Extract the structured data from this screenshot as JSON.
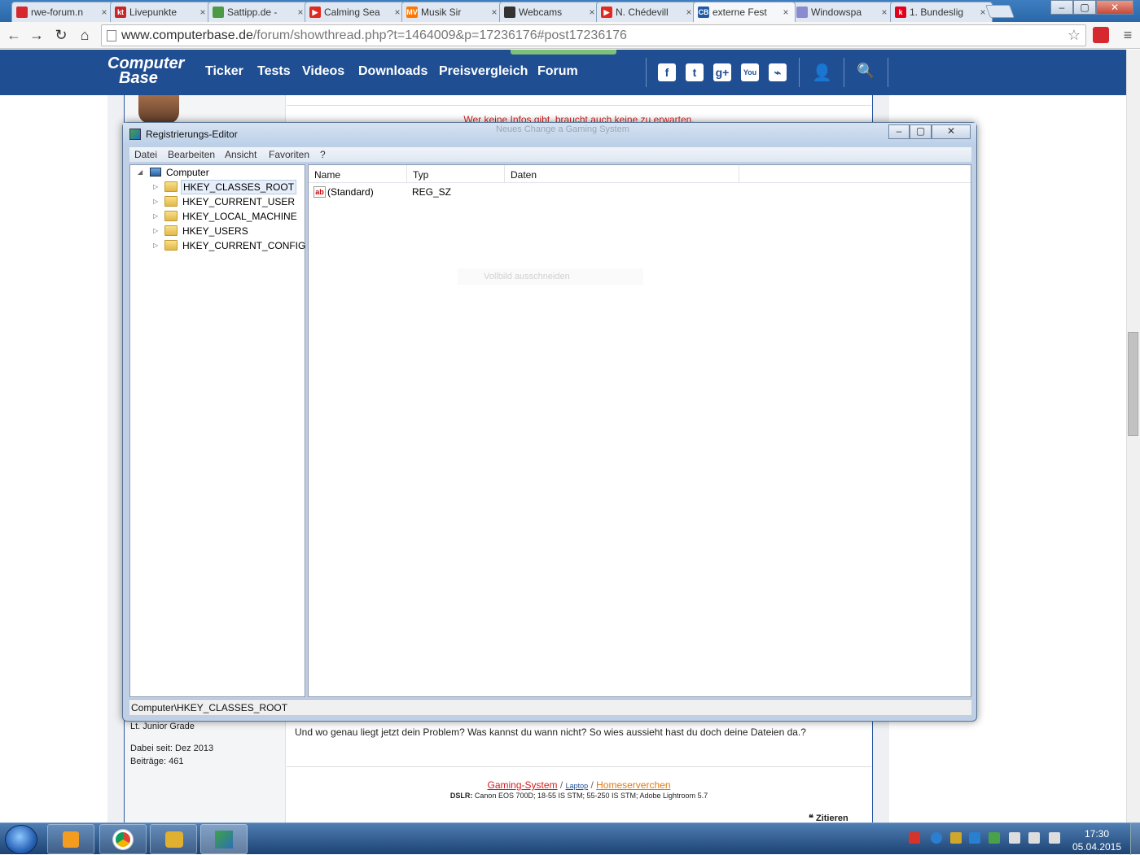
{
  "browser": {
    "tabs": [
      {
        "title": "rwe-forum.n",
        "icon_color": "#d6282f",
        "active": false
      },
      {
        "title": "Livepunkte",
        "icon_color": "#c9262b",
        "active": false
      },
      {
        "title": "Sattipp.de -",
        "icon_color": "#4c9a46",
        "active": false
      },
      {
        "title": "Calming Sea",
        "icon_color": "#e02a20",
        "active": false
      },
      {
        "title": "Musik Sir",
        "icon_color": "#ff7700",
        "active": false
      },
      {
        "title": "Webcams",
        "icon_color": "#333333",
        "active": false
      },
      {
        "title": "N. Chédevill",
        "icon_color": "#e02a20",
        "active": false
      },
      {
        "title": "externe Fest",
        "icon_color": "#1f5ba5",
        "active": true
      },
      {
        "title": "Windowspa",
        "icon_color": "#8a8ad0",
        "active": false
      },
      {
        "title": "1. Bundeslig",
        "icon_color": "#e3001b",
        "active": false
      }
    ],
    "tab_icon_letters": [
      "",
      "kt",
      "",
      "▶",
      "MV",
      "",
      "▶",
      "CB",
      "",
      "k"
    ],
    "tab_close_glyph": "×",
    "window_buttons": {
      "minimize": "–",
      "maximize": "▢",
      "close": "✕"
    },
    "url_domain": "www.computerbase.de",
    "url_path": "/forum/showthread.php?t=1464009&p=17236176#post17236176",
    "nav_icons": [
      "back-icon",
      "forward-icon",
      "reload-icon",
      "home-icon"
    ],
    "nav_glyphs": {
      "back": "←",
      "forward": "→",
      "reload": "↻",
      "home": "⌂",
      "star": "☆",
      "menu": "≡"
    }
  },
  "site": {
    "logo_line1": "Computer",
    "logo_line2": "Base",
    "nav": [
      "Ticker",
      "Tests",
      "Videos",
      "Downloads",
      "Preisvergleich",
      "Forum"
    ],
    "social_icons": [
      "facebook-icon",
      "twitter-icon",
      "google-plus-icon",
      "youtube-icon",
      "rss-icon"
    ],
    "social_glyphs": [
      "f",
      "t",
      "g+",
      "You",
      "⌁"
    ],
    "user_icon": "user-icon",
    "search_icon": "search-icon",
    "header_glyphs": {
      "user": "👤",
      "search": "🔍"
    },
    "accent": "#1f4f92"
  },
  "forum": {
    "red_line": "Wer keine Infos gibt, braucht auch keine zu erwarten.",
    "rank": "Lt. Junior Grade",
    "joined": "Dabei seit: Dez 2013",
    "posts": "Beiträge: 461",
    "post_text": "Und wo genau liegt jetzt dein Problem? Was kannst du wann nicht? So wies aussieht hast du doch deine Dateien da.?",
    "sig_link1": "Gaming-System",
    "sig_sep": "/",
    "sig_link2": "Laptop",
    "sig_link3": "Homeserverchen",
    "sig_dslr_label": "DSLR:",
    "sig_dslr": "Canon EOS 700D; 18-55 IS STM; 55-250 IS STM; Adobe Lightroom 5.7",
    "quote_button": "Zitieren",
    "quote_glyph": "❝"
  },
  "regedit": {
    "title": "Registrierungs-Editor",
    "ghost_title": "Neues Change a Gaming System",
    "menu": [
      "Datei",
      "Bearbeiten",
      "Ansicht",
      "Favoriten",
      "?"
    ],
    "tree_root": "Computer",
    "tree_glyphs": {
      "root_arrow": "◢",
      "item_arrow": "▷"
    },
    "tree_items": [
      "HKEY_CLASSES_ROOT",
      "HKEY_CURRENT_USER",
      "HKEY_LOCAL_MACHINE",
      "HKEY_USERS",
      "HKEY_CURRENT_CONFIG"
    ],
    "selected_item": "HKEY_CLASSES_ROOT",
    "columns": [
      "Name",
      "Typ",
      "Daten"
    ],
    "value_icon_text": "ab",
    "rows": [
      {
        "name": "(Standard)",
        "type": "REG_SZ",
        "data": ""
      }
    ],
    "ghost_tooltip": "Vollbild ausschneiden",
    "status": "Computer\\HKEY_CLASSES_ROOT"
  },
  "taskbar": {
    "time": "17:30",
    "date": "05.04.2015",
    "apps": [
      "media-player-icon",
      "chrome-icon",
      "games-icon",
      "regedit-icon"
    ],
    "tray_icons": [
      "volume-alert-icon",
      "network-icon",
      "flag-icon",
      "monitor-icon",
      "speaker-icon"
    ]
  }
}
